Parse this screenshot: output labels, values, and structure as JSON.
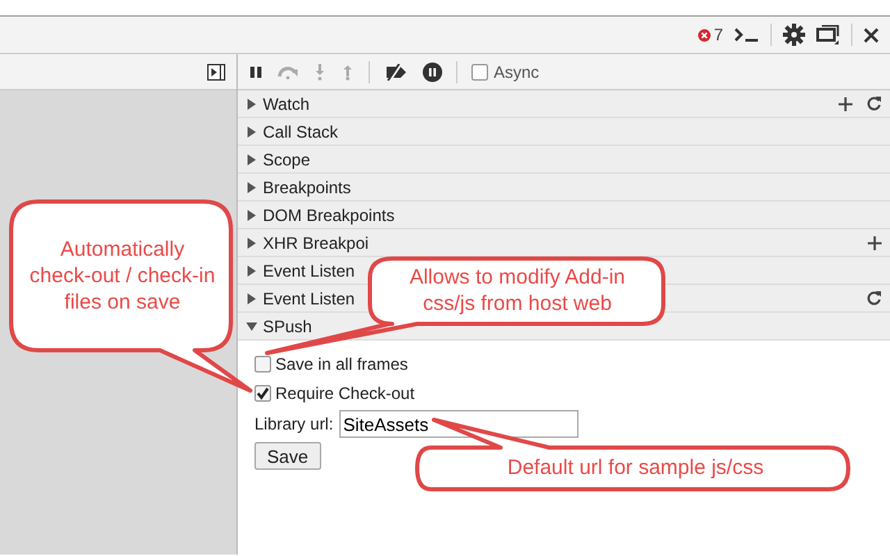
{
  "toolbar": {
    "error_count": "7"
  },
  "debugger_toolbar": {
    "async": {
      "label": "Async",
      "checked": false
    }
  },
  "sections": [
    {
      "label": "Watch",
      "expanded": false,
      "add_button": true,
      "refresh_button": true
    },
    {
      "label": "Call Stack",
      "expanded": false
    },
    {
      "label": "Scope",
      "expanded": false
    },
    {
      "label": "Breakpoints",
      "expanded": false
    },
    {
      "label": "DOM Breakpoints",
      "expanded": false
    },
    {
      "label": "XHR Breakpoi",
      "expanded": false,
      "add_button": true
    },
    {
      "label": "Event Listen",
      "expanded": false
    },
    {
      "label": "Event Listen",
      "expanded": false,
      "refresh_button": true
    },
    {
      "label": "SPush",
      "expanded": true
    }
  ],
  "spush": {
    "options": [
      {
        "label": "Save in all frames",
        "checked": false
      },
      {
        "label": "Require Check-out",
        "checked": true
      }
    ],
    "library_url": {
      "label": "Library url:",
      "value": "SiteAssets"
    },
    "save_button": "Save"
  },
  "callouts": [
    {
      "text": "Automatically check-out / check-in files on save"
    },
    {
      "text": "Allows to modify Add-in css/js from host web"
    },
    {
      "text": "Default url for sample js/css"
    }
  ]
}
